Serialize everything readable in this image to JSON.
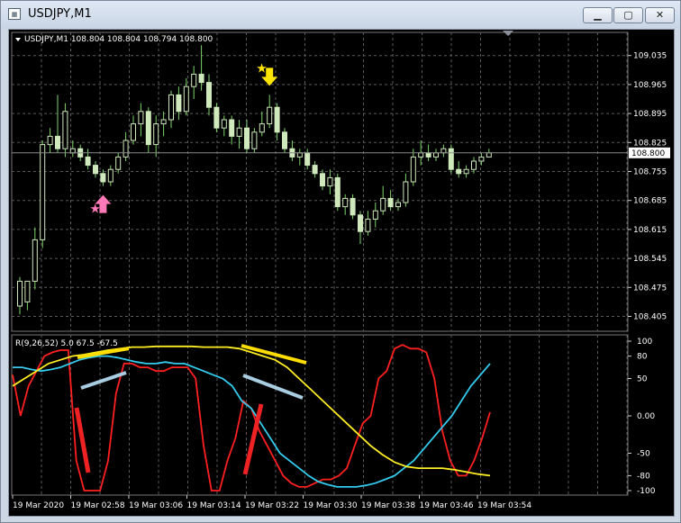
{
  "window": {
    "title": "USDJPY,M1",
    "minimize": "▁",
    "maximize": "▢",
    "close": "✕"
  },
  "chart": {
    "header": "USDJPY,M1  108.804 108.804 108.794 108.800",
    "price_labels": [
      "109.035",
      "108.965",
      "108.895",
      "108.825",
      "108.755",
      "108.685",
      "108.615",
      "108.545",
      "108.475",
      "108.405"
    ],
    "current_price": "108.800",
    "time_labels": [
      "19 Mar 2020",
      "19 Mar 02:58",
      "19 Mar 03:06",
      "19 Mar 03:14",
      "19 Mar 03:22",
      "19 Mar 03:30",
      "19 Mar 03:38",
      "19 Mar 03:46",
      "19 Mar 03:54"
    ],
    "colors": {
      "background": "#000000",
      "grid": "#5a5a5a",
      "candle": "#cfe8bc",
      "wick": "#7dd36a",
      "arrow_up": "#ff79b8",
      "arrow_down": "#ffe400",
      "star_up": "#ff79b8",
      "star_down": "#ffe400"
    }
  },
  "indicator": {
    "header": "R(9,26,52) 5.0 67.5 -67.5",
    "levels": [
      "100",
      "80",
      "50",
      "0.00",
      "-50",
      "-80",
      "-100"
    ],
    "colors": {
      "fast": "#ff2020",
      "mid": "#33ccee",
      "slow": "#ffee22",
      "slow_mark": "#ffdd00",
      "mid_mark": "#a8cce0",
      "fast_mark": "#ee2222"
    }
  },
  "chart_data": {
    "type": "candlestick",
    "symbol": "USDJPY",
    "timeframe": "M1",
    "ylim": [
      108.38,
      109.08
    ],
    "candles": [
      {
        "o": 108.43,
        "h": 108.5,
        "l": 108.41,
        "c": 108.49
      },
      {
        "o": 108.44,
        "h": 108.49,
        "l": 108.42,
        "c": 108.49
      },
      {
        "o": 108.49,
        "h": 108.62,
        "l": 108.47,
        "c": 108.59
      },
      {
        "o": 108.59,
        "h": 108.83,
        "l": 108.57,
        "c": 108.82
      },
      {
        "o": 108.82,
        "h": 108.86,
        "l": 108.8,
        "c": 108.84
      },
      {
        "o": 108.84,
        "h": 108.94,
        "l": 108.8,
        "c": 108.81
      },
      {
        "o": 108.81,
        "h": 108.92,
        "l": 108.79,
        "c": 108.9
      },
      {
        "o": 108.8,
        "h": 108.83,
        "l": 108.79,
        "c": 108.81
      },
      {
        "o": 108.81,
        "h": 108.82,
        "l": 108.78,
        "c": 108.79
      },
      {
        "o": 108.79,
        "h": 108.81,
        "l": 108.76,
        "c": 108.77
      },
      {
        "o": 108.77,
        "h": 108.78,
        "l": 108.74,
        "c": 108.75
      },
      {
        "o": 108.75,
        "h": 108.76,
        "l": 108.72,
        "c": 108.73
      },
      {
        "o": 108.73,
        "h": 108.77,
        "l": 108.72,
        "c": 108.76
      },
      {
        "o": 108.76,
        "h": 108.8,
        "l": 108.75,
        "c": 108.79
      },
      {
        "o": 108.79,
        "h": 108.85,
        "l": 108.78,
        "c": 108.83
      },
      {
        "o": 108.83,
        "h": 108.89,
        "l": 108.82,
        "c": 108.87
      },
      {
        "o": 108.87,
        "h": 108.92,
        "l": 108.84,
        "c": 108.9
      },
      {
        "o": 108.9,
        "h": 108.91,
        "l": 108.8,
        "c": 108.82
      },
      {
        "o": 108.82,
        "h": 108.89,
        "l": 108.79,
        "c": 108.87
      },
      {
        "o": 108.87,
        "h": 108.9,
        "l": 108.84,
        "c": 108.88
      },
      {
        "o": 108.88,
        "h": 108.95,
        "l": 108.86,
        "c": 108.94
      },
      {
        "o": 108.94,
        "h": 108.96,
        "l": 108.88,
        "c": 108.9
      },
      {
        "o": 108.9,
        "h": 108.98,
        "l": 108.89,
        "c": 108.96
      },
      {
        "o": 108.96,
        "h": 109.01,
        "l": 108.93,
        "c": 108.99
      },
      {
        "o": 108.99,
        "h": 109.06,
        "l": 108.95,
        "c": 108.97
      },
      {
        "o": 108.97,
        "h": 108.99,
        "l": 108.89,
        "c": 108.91
      },
      {
        "o": 108.91,
        "h": 108.92,
        "l": 108.85,
        "c": 108.86
      },
      {
        "o": 108.86,
        "h": 108.89,
        "l": 108.84,
        "c": 108.88
      },
      {
        "o": 108.88,
        "h": 108.89,
        "l": 108.82,
        "c": 108.84
      },
      {
        "o": 108.84,
        "h": 108.88,
        "l": 108.81,
        "c": 108.86
      },
      {
        "o": 108.86,
        "h": 108.88,
        "l": 108.8,
        "c": 108.81
      },
      {
        "o": 108.81,
        "h": 108.86,
        "l": 108.8,
        "c": 108.85
      },
      {
        "o": 108.85,
        "h": 108.9,
        "l": 108.84,
        "c": 108.87
      },
      {
        "o": 108.87,
        "h": 108.94,
        "l": 108.86,
        "c": 108.91
      },
      {
        "o": 108.91,
        "h": 108.92,
        "l": 108.83,
        "c": 108.85
      },
      {
        "o": 108.85,
        "h": 108.86,
        "l": 108.8,
        "c": 108.81
      },
      {
        "o": 108.81,
        "h": 108.83,
        "l": 108.78,
        "c": 108.79
      },
      {
        "o": 108.79,
        "h": 108.81,
        "l": 108.77,
        "c": 108.8
      },
      {
        "o": 108.8,
        "h": 108.81,
        "l": 108.76,
        "c": 108.77
      },
      {
        "o": 108.77,
        "h": 108.78,
        "l": 108.74,
        "c": 108.75
      },
      {
        "o": 108.75,
        "h": 108.76,
        "l": 108.71,
        "c": 108.72
      },
      {
        "o": 108.72,
        "h": 108.76,
        "l": 108.7,
        "c": 108.74
      },
      {
        "o": 108.74,
        "h": 108.75,
        "l": 108.66,
        "c": 108.67
      },
      {
        "o": 108.67,
        "h": 108.7,
        "l": 108.65,
        "c": 108.69
      },
      {
        "o": 108.69,
        "h": 108.7,
        "l": 108.64,
        "c": 108.65
      },
      {
        "o": 108.65,
        "h": 108.66,
        "l": 108.58,
        "c": 108.61
      },
      {
        "o": 108.61,
        "h": 108.66,
        "l": 108.6,
        "c": 108.64
      },
      {
        "o": 108.64,
        "h": 108.68,
        "l": 108.62,
        "c": 108.66
      },
      {
        "o": 108.66,
        "h": 108.72,
        "l": 108.65,
        "c": 108.69
      },
      {
        "o": 108.69,
        "h": 108.71,
        "l": 108.66,
        "c": 108.67
      },
      {
        "o": 108.67,
        "h": 108.69,
        "l": 108.66,
        "c": 108.68
      },
      {
        "o": 108.68,
        "h": 108.75,
        "l": 108.67,
        "c": 108.73
      },
      {
        "o": 108.73,
        "h": 108.81,
        "l": 108.72,
        "c": 108.79
      },
      {
        "o": 108.79,
        "h": 108.83,
        "l": 108.77,
        "c": 108.8
      },
      {
        "o": 108.8,
        "h": 108.82,
        "l": 108.78,
        "c": 108.79
      },
      {
        "o": 108.79,
        "h": 108.81,
        "l": 108.78,
        "c": 108.8
      },
      {
        "o": 108.8,
        "h": 108.82,
        "l": 108.79,
        "c": 108.81
      },
      {
        "o": 108.81,
        "h": 108.82,
        "l": 108.75,
        "c": 108.76
      },
      {
        "o": 108.76,
        "h": 108.78,
        "l": 108.74,
        "c": 108.75
      },
      {
        "o": 108.75,
        "h": 108.77,
        "l": 108.74,
        "c": 108.76
      },
      {
        "o": 108.76,
        "h": 108.79,
        "l": 108.75,
        "c": 108.78
      },
      {
        "o": 108.78,
        "h": 108.8,
        "l": 108.77,
        "c": 108.79
      },
      {
        "o": 108.79,
        "h": 108.81,
        "l": 108.79,
        "c": 108.8
      }
    ],
    "signals": [
      {
        "candle": 11,
        "type": "buy"
      },
      {
        "candle": 33,
        "type": "sell"
      }
    ],
    "oscillator": {
      "ylim": [
        -100,
        100
      ],
      "series": [
        {
          "values": [
            55,
            0,
            40,
            60,
            80,
            85,
            88,
            88,
            -60,
            -100,
            -100,
            -100,
            -60,
            30,
            70,
            70,
            65,
            65,
            60,
            60,
            65,
            65,
            65,
            50,
            -40,
            -100,
            -100,
            -60,
            -30,
            20,
            10,
            -20,
            -40,
            -60,
            -80,
            -90,
            -95,
            -95,
            -90,
            -85,
            -85,
            -80,
            -70,
            -40,
            -10,
            0,
            50,
            60,
            90,
            95,
            90,
            90,
            85,
            50,
            -20,
            -60,
            -80,
            -80,
            -60,
            -30,
            5
          ]
        },
        {
          "values": [
            65,
            65,
            62,
            60,
            62,
            65,
            70,
            75,
            78,
            80,
            80,
            78,
            75,
            72,
            70,
            70,
            72,
            70,
            70,
            65,
            60,
            55,
            50,
            40,
            20,
            10,
            -10,
            -30,
            -50,
            -60,
            -70,
            -80,
            -88,
            -92,
            -95,
            -95,
            -95,
            -93,
            -90,
            -85,
            -80,
            -70,
            -60,
            -45,
            -30,
            -15,
            0,
            20,
            40,
            55,
            70
          ]
        },
        {
          "values": [
            40,
            50,
            60,
            70,
            75,
            80,
            82,
            85,
            88,
            90,
            92,
            92,
            93,
            93,
            93,
            93,
            92,
            92,
            92,
            90,
            85,
            80,
            75,
            65,
            50,
            35,
            20,
            5,
            -10,
            -25,
            -40,
            -52,
            -62,
            -68,
            -70,
            -70,
            -70,
            -72,
            -75,
            -78,
            -80
          ]
        }
      ]
    }
  }
}
